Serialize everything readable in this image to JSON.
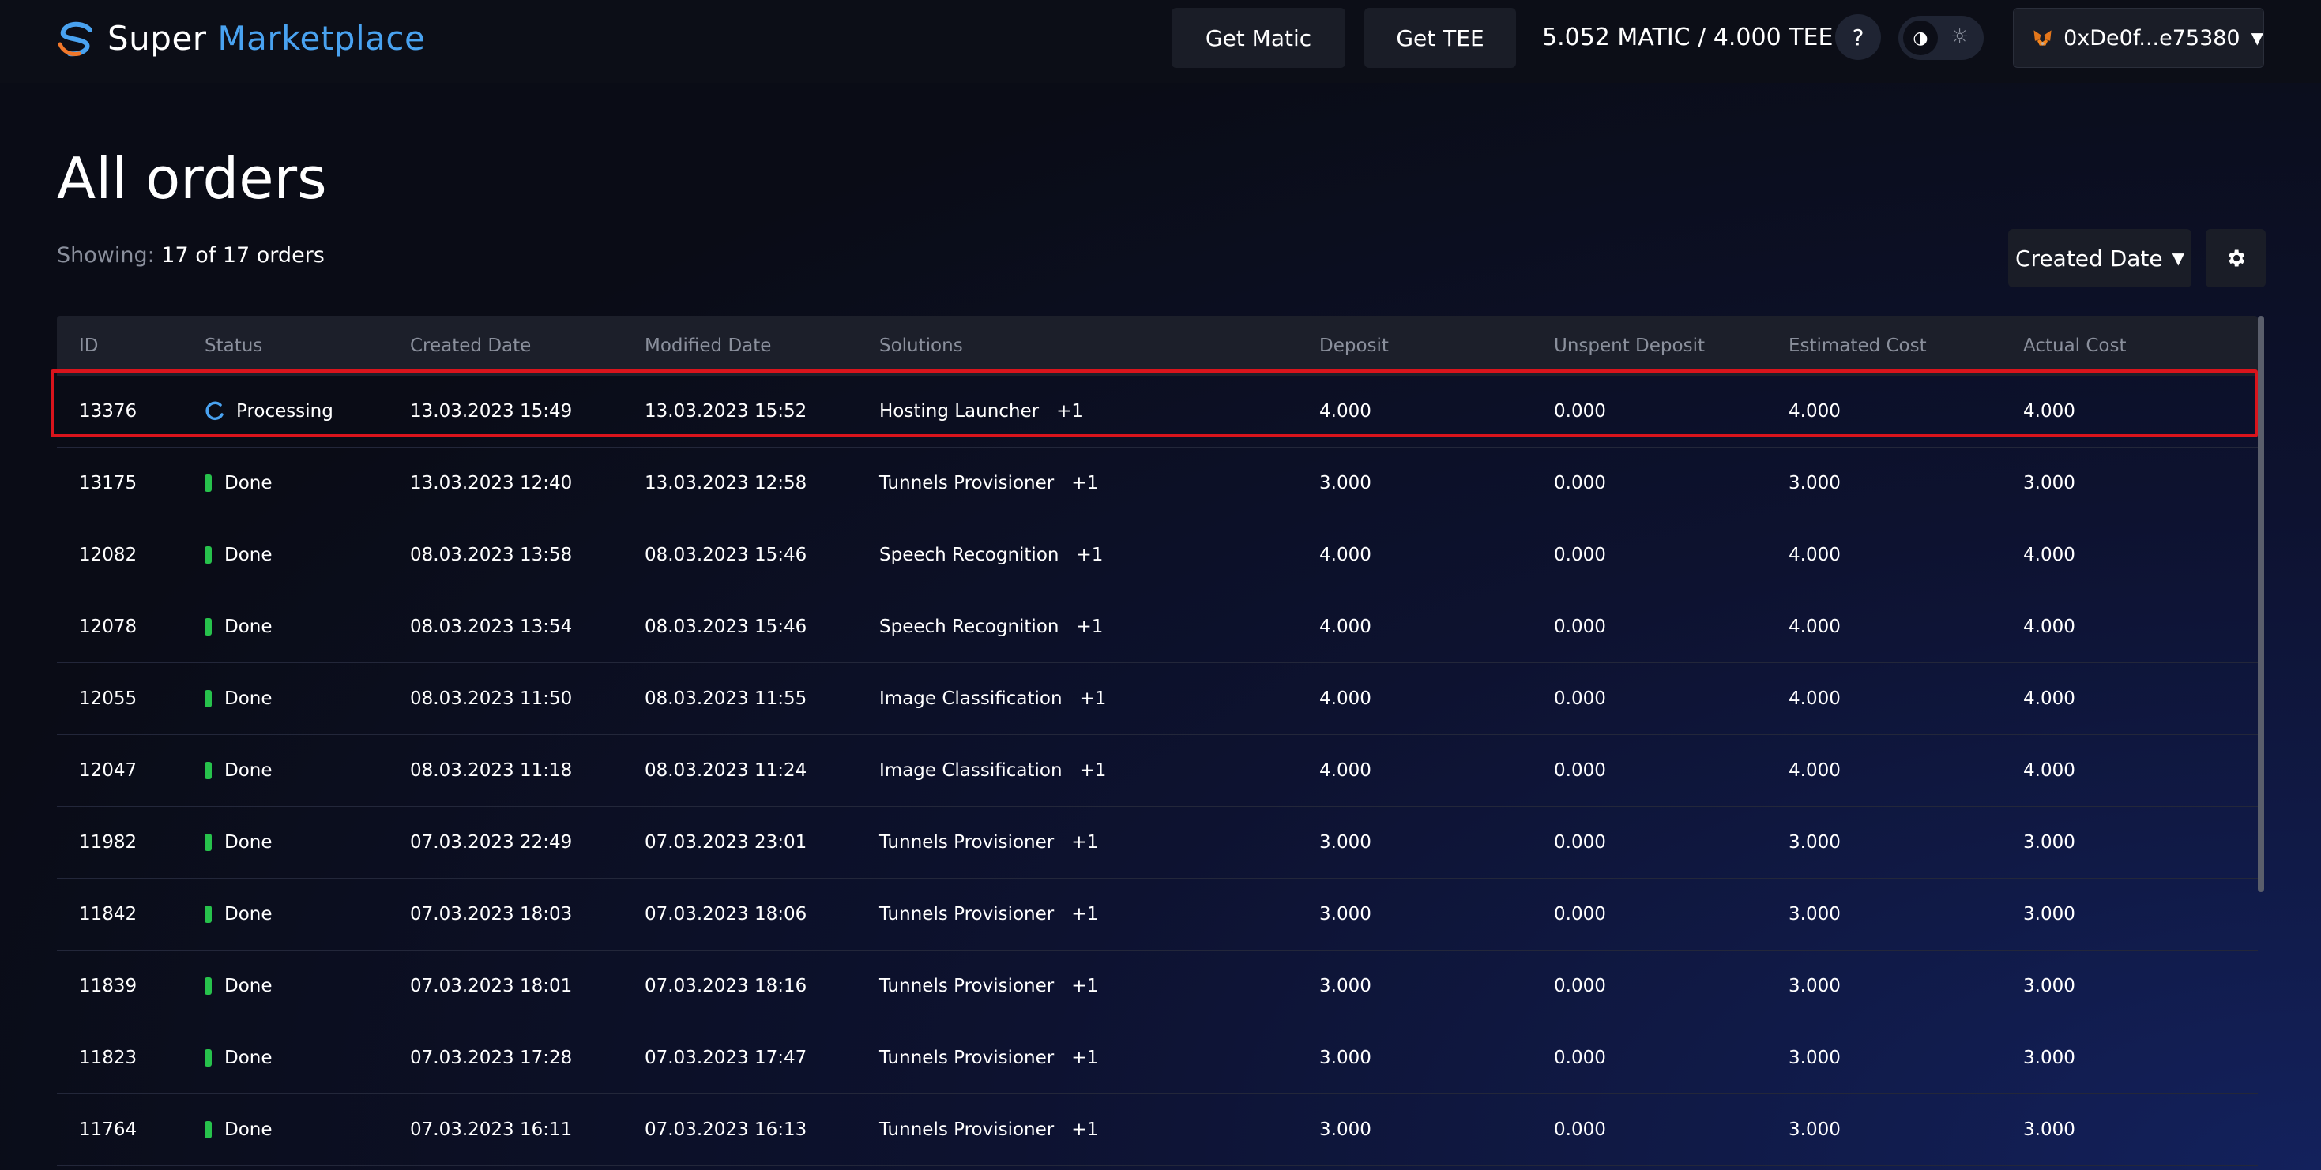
{
  "header": {
    "logo_word1": "Super",
    "logo_word2": "Marketplace",
    "get_matic_label": "Get Matic",
    "get_tee_label": "Get TEE",
    "balance": "5.052 MATIC / 4.000 TEE",
    "help_label": "?",
    "wallet_address": "0xDe0f...e75380"
  },
  "page": {
    "title": "All orders",
    "showing_label": "Showing:",
    "showing_value": "17 of 17 orders",
    "sort_label": "Created Date"
  },
  "colors": {
    "accent": "#49a2f0",
    "done": "#27c24c",
    "highlight": "#d9141c",
    "processing": "#49a2f0"
  },
  "table": {
    "columns": [
      "ID",
      "Status",
      "Created Date",
      "Modified Date",
      "Solutions",
      "Deposit",
      "Unspent Deposit",
      "Estimated Cost",
      "Actual Cost"
    ],
    "rows": [
      {
        "id": "13376",
        "status": "Processing",
        "created": "13.03.2023 15:49",
        "modified": "13.03.2023 15:52",
        "solution": "Hosting Launcher",
        "extra": "+1",
        "deposit": "4.000",
        "unspent": "0.000",
        "estimated": "4.000",
        "actual": "4.000"
      },
      {
        "id": "13175",
        "status": "Done",
        "created": "13.03.2023 12:40",
        "modified": "13.03.2023 12:58",
        "solution": "Tunnels Provisioner",
        "extra": "+1",
        "deposit": "3.000",
        "unspent": "0.000",
        "estimated": "3.000",
        "actual": "3.000"
      },
      {
        "id": "12082",
        "status": "Done",
        "created": "08.03.2023 13:58",
        "modified": "08.03.2023 15:46",
        "solution": "Speech Recognition",
        "extra": "+1",
        "deposit": "4.000",
        "unspent": "0.000",
        "estimated": "4.000",
        "actual": "4.000"
      },
      {
        "id": "12078",
        "status": "Done",
        "created": "08.03.2023 13:54",
        "modified": "08.03.2023 15:46",
        "solution": "Speech Recognition",
        "extra": "+1",
        "deposit": "4.000",
        "unspent": "0.000",
        "estimated": "4.000",
        "actual": "4.000"
      },
      {
        "id": "12055",
        "status": "Done",
        "created": "08.03.2023 11:50",
        "modified": "08.03.2023 11:55",
        "solution": "Image Classification",
        "extra": "+1",
        "deposit": "4.000",
        "unspent": "0.000",
        "estimated": "4.000",
        "actual": "4.000"
      },
      {
        "id": "12047",
        "status": "Done",
        "created": "08.03.2023 11:18",
        "modified": "08.03.2023 11:24",
        "solution": "Image Classification",
        "extra": "+1",
        "deposit": "4.000",
        "unspent": "0.000",
        "estimated": "4.000",
        "actual": "4.000"
      },
      {
        "id": "11982",
        "status": "Done",
        "created": "07.03.2023 22:49",
        "modified": "07.03.2023 23:01",
        "solution": "Tunnels Provisioner",
        "extra": "+1",
        "deposit": "3.000",
        "unspent": "0.000",
        "estimated": "3.000",
        "actual": "3.000"
      },
      {
        "id": "11842",
        "status": "Done",
        "created": "07.03.2023 18:03",
        "modified": "07.03.2023 18:06",
        "solution": "Tunnels Provisioner",
        "extra": "+1",
        "deposit": "3.000",
        "unspent": "0.000",
        "estimated": "3.000",
        "actual": "3.000"
      },
      {
        "id": "11839",
        "status": "Done",
        "created": "07.03.2023 18:01",
        "modified": "07.03.2023 18:16",
        "solution": "Tunnels Provisioner",
        "extra": "+1",
        "deposit": "3.000",
        "unspent": "0.000",
        "estimated": "3.000",
        "actual": "3.000"
      },
      {
        "id": "11823",
        "status": "Done",
        "created": "07.03.2023 17:28",
        "modified": "07.03.2023 17:47",
        "solution": "Tunnels Provisioner",
        "extra": "+1",
        "deposit": "3.000",
        "unspent": "0.000",
        "estimated": "3.000",
        "actual": "3.000"
      },
      {
        "id": "11764",
        "status": "Done",
        "created": "07.03.2023 16:11",
        "modified": "07.03.2023 16:13",
        "solution": "Tunnels Provisioner",
        "extra": "+1",
        "deposit": "3.000",
        "unspent": "0.000",
        "estimated": "3.000",
        "actual": "3.000"
      }
    ]
  }
}
